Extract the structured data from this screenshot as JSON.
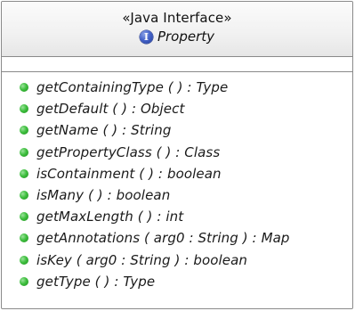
{
  "interface": {
    "stereotype": "«Java Interface»",
    "icon": "interface-icon",
    "icon_glyph": "I",
    "name": "Property"
  },
  "operations": [
    "getContainingType ( ) : Type",
    "getDefault ( ) : Object",
    "getName ( ) : String",
    "getPropertyClass ( ) : Class",
    "isContainment ( ) : boolean",
    "isMany ( ) : boolean",
    "getMaxLength ( ) : int",
    "getAnnotations ( arg0 : String ) : Map",
    "isKey ( arg0 : String ) : boolean",
    "getType ( ) : Type"
  ],
  "colors": {
    "operation_dot": "#3fbf3f",
    "interface_icon": "#4563c9",
    "border": "#8a8a8a"
  }
}
